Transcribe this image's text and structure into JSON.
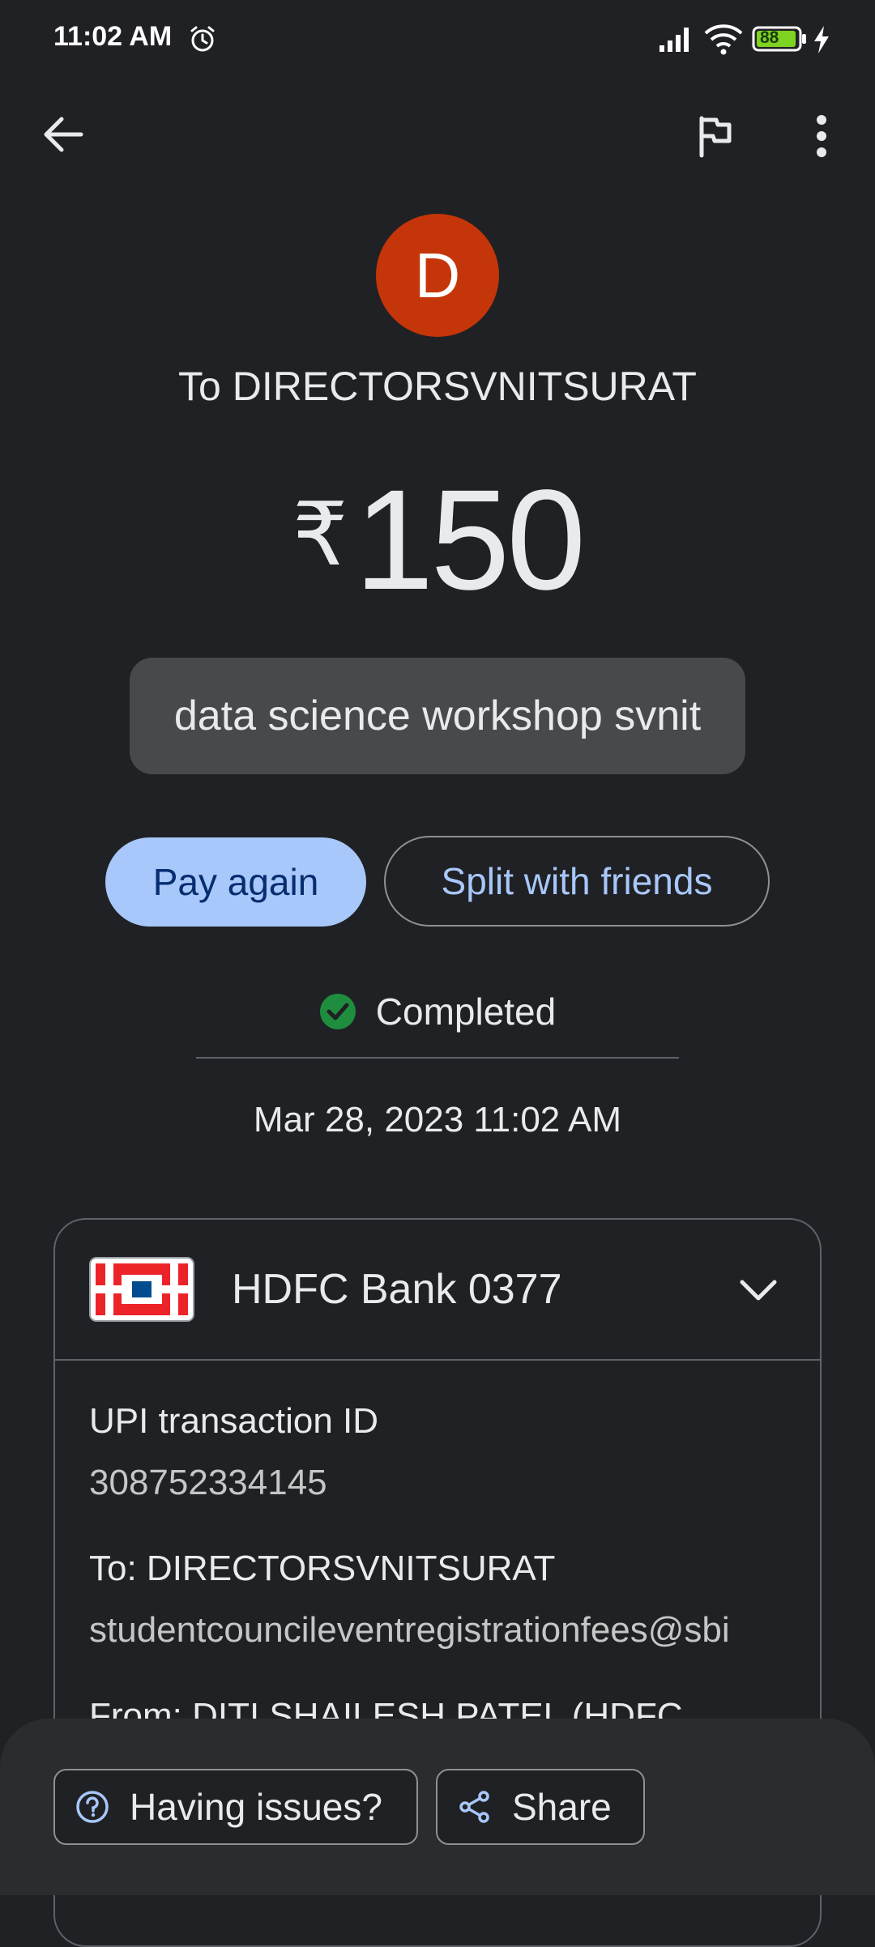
{
  "status_bar": {
    "time": "11:02 AM",
    "battery": "88"
  },
  "payee": {
    "initial": "D",
    "title": "To DIRECTORSVNITSURAT"
  },
  "amount": {
    "currency": "₹",
    "value": "150"
  },
  "note": "data science workshop svnit",
  "actions": {
    "pay_again": "Pay again",
    "split": "Split with friends"
  },
  "status": {
    "label": "Completed",
    "datetime": "Mar 28, 2023 11:02 AM"
  },
  "bank": {
    "name": "HDFC Bank 0377"
  },
  "details": {
    "upi_label": "UPI transaction ID",
    "upi_id": "308752334145",
    "to_label": "To: DIRECTORSVNITSURAT",
    "to_value": "studentcouncileventregistrationfees@sbi",
    "from_label": "From: DITI SHAILESH PATEL (HDFC"
  },
  "bottom": {
    "issues": "Having issues?",
    "share": "Share"
  },
  "colors": {
    "accent": "#a8c7fa",
    "avatar": "#c5350a",
    "success": "#1e8e3e"
  }
}
